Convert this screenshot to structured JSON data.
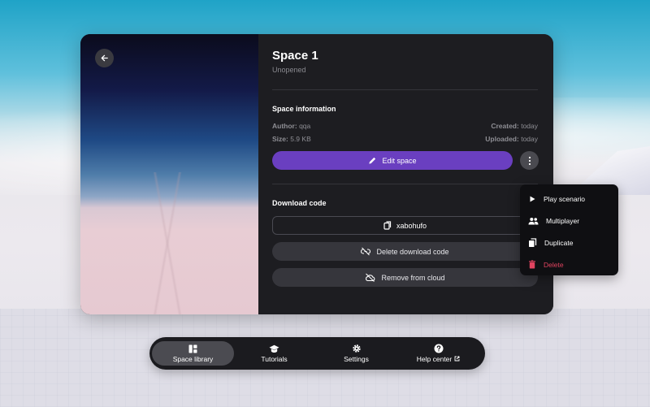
{
  "space": {
    "title": "Space 1",
    "status": "Unopened"
  },
  "info_section": {
    "heading": "Space information",
    "author_label": "Author:",
    "author_value": "qqa",
    "size_label": "Size:",
    "size_value": "5.9 KB",
    "created_label": "Created:",
    "created_value": "today",
    "uploaded_label": "Uploaded:",
    "uploaded_value": "today"
  },
  "actions": {
    "edit_label": "Edit space"
  },
  "download": {
    "heading": "Download code",
    "code": "xabohufo",
    "delete_label": "Delete download code",
    "remove_label": "Remove from cloud"
  },
  "context_menu": {
    "items": [
      {
        "label": "Play scenario",
        "icon": "play-icon"
      },
      {
        "label": "Multiplayer",
        "icon": "people-icon"
      },
      {
        "label": "Duplicate",
        "icon": "copy-icon"
      },
      {
        "label": "Delete",
        "icon": "trash-icon",
        "color": "#e0435f"
      }
    ]
  },
  "navbar": {
    "items": [
      {
        "label": "Space library",
        "icon": "library-icon",
        "active": true
      },
      {
        "label": "Tutorials",
        "icon": "graduation-cap-icon"
      },
      {
        "label": "Settings",
        "icon": "gear-icon"
      },
      {
        "label": "Help center",
        "icon": "help-icon"
      }
    ]
  },
  "colors": {
    "accent": "#6a3fc0",
    "danger": "#e0435f",
    "panel": "#1d1d21"
  }
}
